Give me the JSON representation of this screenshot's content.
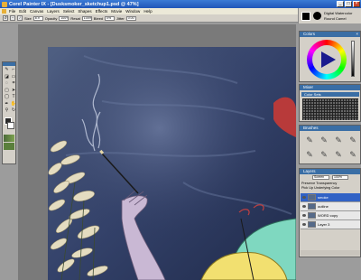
{
  "window": {
    "title": "Corel Painter IX - [Dusksmoker_sketchup1.psd @ 47%]"
  },
  "menu": [
    "File",
    "Edit",
    "Canvas",
    "Layers",
    "Select",
    "Shapes",
    "Effects",
    "Movie",
    "Window",
    "Help"
  ],
  "propbar": {
    "size_label": "Size",
    "size_value": "8.9",
    "opacity_label": "Opacity",
    "opacity_value": "100%",
    "resat_label": "Resat",
    "resat_value": "100%",
    "bleed_label": "Bleed",
    "bleed_value": "0%",
    "jitter_label": "Jitter",
    "jitter_value": "0.00"
  },
  "brush_selector": {
    "category": "Digital Watercolor",
    "variant": "Round Camel"
  },
  "panels": {
    "colors": "Colors",
    "mixer": "Mixer",
    "color_sets": "Color Sets",
    "brushes": "Brushes",
    "layers": "Layers"
  },
  "layers": {
    "composite": "Screen",
    "opacity": "100%",
    "preserve_transparency": "Preserve Transparency",
    "pick_up_underlying": "Pick Up Underlying Color",
    "items": [
      {
        "name": "smoke",
        "selected": true
      },
      {
        "name": "outline",
        "selected": false
      },
      {
        "name": "WORD copy",
        "selected": false
      },
      {
        "name": "Layer 3",
        "selected": false
      }
    ]
  },
  "colors": {
    "accent": "#3a6ea5",
    "canvas_bg": "#3b4a6b"
  }
}
